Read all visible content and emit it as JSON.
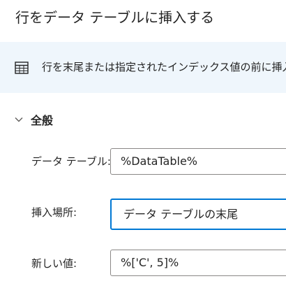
{
  "dialog": {
    "title": "行をデータ テーブルに挿入する"
  },
  "info": {
    "icon": "table-icon",
    "text": "行を末尾または指定されたインデックス値の前に挿入します"
  },
  "section": {
    "icon": "chevron-down-icon",
    "title": "全般"
  },
  "fields": {
    "data_table": {
      "label": "データ テーブル:",
      "value": "%DataTable%"
    },
    "insert_location": {
      "label": "挿入場所:",
      "value": "データ テーブルの末尾"
    },
    "new_value": {
      "label": "新しい値:",
      "value": "%['C', 5]%"
    }
  },
  "colors": {
    "accent": "#0078d4",
    "info_background": "#eff6fc",
    "border": "#8a8886"
  }
}
